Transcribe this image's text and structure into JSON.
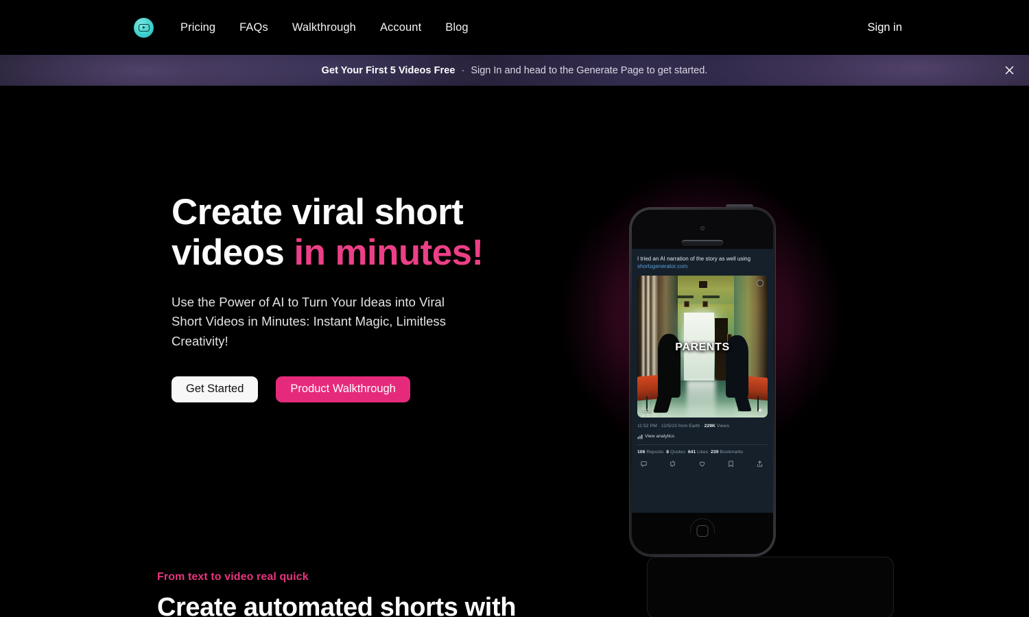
{
  "nav": {
    "logo_icon": "play-circle-logo",
    "links": [
      {
        "label": "Pricing"
      },
      {
        "label": "FAQs"
      },
      {
        "label": "Walkthrough"
      },
      {
        "label": "Account"
      },
      {
        "label": "Blog"
      }
    ],
    "signin_label": "Sign in"
  },
  "banner": {
    "bold": "Get Your First 5 Videos Free",
    "separator": "·",
    "text": "Sign In and head to the Generate Page to get started.",
    "close_icon": "close-icon"
  },
  "hero": {
    "heading_part1": "Create viral short videos ",
    "heading_accent": "in minutes!",
    "subheading": "Use the Power of AI to Turn Your Ideas into Viral Short Videos in Minutes: Instant Magic, Limitless Creativity!",
    "primary_button": "Get Started",
    "secondary_button": "Product Walkthrough",
    "accent_color": "#ec3f86",
    "button_pink": "#e62a7b"
  },
  "phone": {
    "tweet_text": "I tried an AI narration of the story as well using",
    "tweet_link": "shortsgenerator.com",
    "media_caption": "PARENTS",
    "media_duration": "1:02",
    "sound_icon": "sound-on-icon",
    "meta_time": "11:52 PM",
    "meta_date": "12/5/23",
    "meta_source": "from Earth",
    "meta_views_count": "229K",
    "meta_views_label": "Views",
    "analytics_label": "View analytics",
    "analytics_icon": "bar-chart-icon",
    "counts": [
      {
        "value": "106",
        "label": "Reposts"
      },
      {
        "value": "8",
        "label": "Quotes"
      },
      {
        "value": "641",
        "label": "Likes"
      },
      {
        "value": "239",
        "label": "Bookmarks"
      }
    ],
    "actions": [
      {
        "icon": "reply-icon"
      },
      {
        "icon": "repost-icon"
      },
      {
        "icon": "like-heart-icon"
      },
      {
        "icon": "bookmark-icon"
      },
      {
        "icon": "share-icon"
      }
    ]
  },
  "section2": {
    "eyebrow": "From text to video real quick",
    "heading": "Create automated shorts with"
  }
}
